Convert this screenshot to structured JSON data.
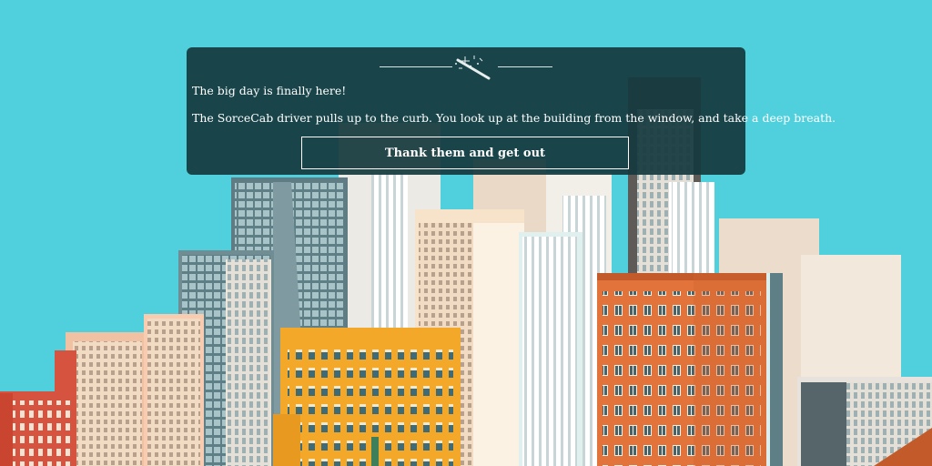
{
  "dialog": {
    "paragraphs": [
      "The big day is finally here!",
      "The SorceCab driver pulls up to the curb. You look up at the building from the window, and take a deep breath."
    ],
    "action_label": "Thank them and get out",
    "divider_icon": "magic-wand-icon"
  },
  "colors": {
    "sky": "#4fd0dc",
    "dialog_background": "#163a3e",
    "text": "#ffffff"
  }
}
